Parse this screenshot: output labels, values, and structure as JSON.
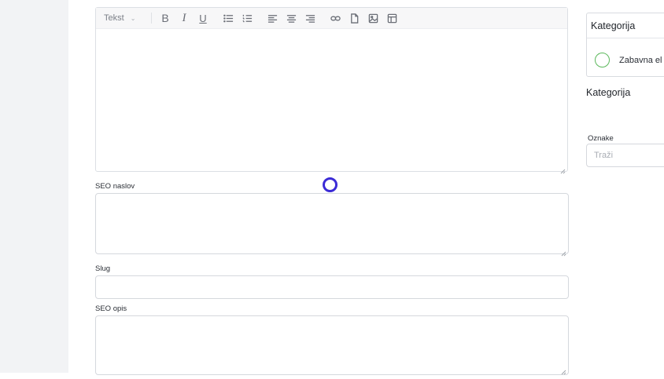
{
  "editor": {
    "format_select": "Tekst",
    "toolbar_icons": [
      "bold-icon",
      "italic-icon",
      "underline-icon",
      "bullet-list-icon",
      "numbered-list-icon",
      "align-left-icon",
      "align-center-icon",
      "align-right-icon",
      "link-icon",
      "file-icon",
      "image-icon",
      "table-icon"
    ]
  },
  "fields": {
    "seo_title_label": "SEO naslov",
    "slug_label": "Slug",
    "seo_description_label": "SEO opis"
  },
  "sidebar": {
    "category_card_title": "Kategorija",
    "category_option": "Zabavna el",
    "category_heading": "Kategorija",
    "tags_label": "Oznake",
    "tags_placeholder": "Traži"
  },
  "colors": {
    "cursor_ring": "#3b2bd6",
    "radio_border": "#5cb85c"
  }
}
